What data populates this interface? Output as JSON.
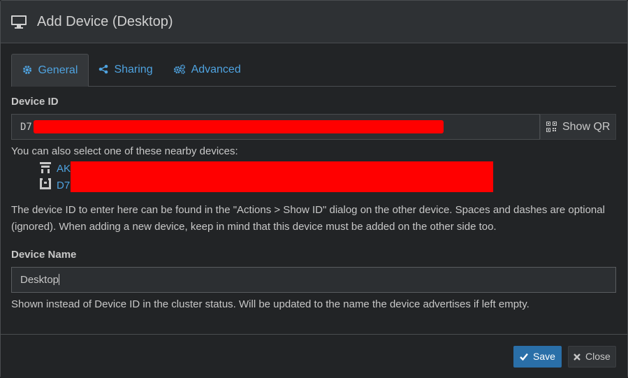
{
  "header": {
    "title": "Add Device (Desktop)",
    "icon": "desktop-icon"
  },
  "tabs": [
    {
      "label": "General",
      "icon": "gear-icon",
      "active": true
    },
    {
      "label": "Sharing",
      "icon": "share-icon",
      "active": false
    },
    {
      "label": "Advanced",
      "icon": "gears-icon",
      "active": false
    }
  ],
  "device_id": {
    "label": "Device ID",
    "value": "D7",
    "show_qr_label": "Show QR"
  },
  "nearby": {
    "intro": "You can also select one of these nearby devices:",
    "devices": [
      {
        "label": "AK"
      },
      {
        "label": "D7"
      }
    ]
  },
  "help_id": "The device ID to enter here can be found in the \"Actions > Show ID\" dialog on the other device. Spaces and dashes are optional (ignored). When adding a new device, keep in mind that this device must be added on the other side too.",
  "device_name": {
    "label": "Device Name",
    "value": "Desktop",
    "help": "Shown instead of Device ID in the cluster status. Will be updated to the name the device advertises if left empty."
  },
  "footer": {
    "save_label": "Save",
    "close_label": "Close"
  },
  "colors": {
    "accent": "#4fa3e0",
    "primary": "#2a6fa8",
    "redaction": "#ff0000"
  }
}
